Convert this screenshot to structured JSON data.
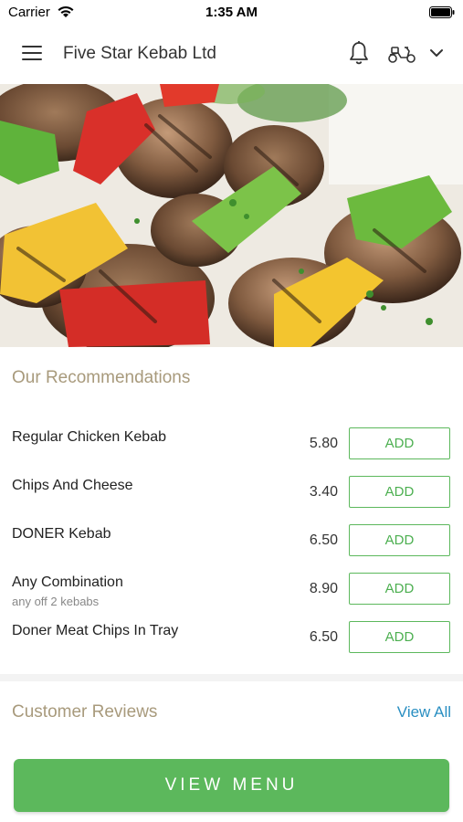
{
  "status_bar": {
    "carrier": "Carrier",
    "time": "1:35 AM"
  },
  "header": {
    "title": "Five Star Kebab Ltd"
  },
  "icons": {
    "menu": "hamburger-menu-icon",
    "notifications": "bell-icon",
    "delivery_mode": "scooter-icon",
    "dropdown": "chevron-down-icon"
  },
  "recommendations": {
    "title": "Our Recommendations",
    "items": [
      {
        "name": "Regular Chicken Kebab",
        "note": "",
        "price": "5.80",
        "action": "ADD"
      },
      {
        "name": "Chips And Cheese",
        "note": "",
        "price": "3.40",
        "action": "ADD"
      },
      {
        "name": "DONER Kebab",
        "note": "",
        "price": "6.50",
        "action": "ADD"
      },
      {
        "name": "Any Combination",
        "note": "any off 2 kebabs",
        "price": "8.90",
        "action": "ADD"
      },
      {
        "name": "Doner Meat Chips In Tray",
        "note": "",
        "price": "6.50",
        "action": "ADD"
      }
    ]
  },
  "reviews": {
    "title": "Customer Reviews",
    "view_all": "View All"
  },
  "footer": {
    "view_menu": "VIEW MENU"
  },
  "colors": {
    "accent_green": "#5cb85c",
    "section_title": "#a89a7c",
    "link_blue": "#2a8fc2"
  }
}
